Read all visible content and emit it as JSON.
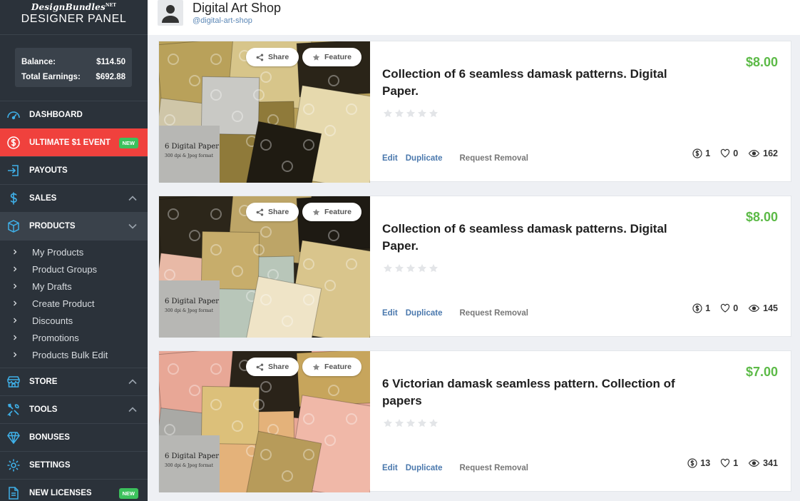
{
  "brand": {
    "logo": "DesignBundles",
    "logo_suffix": "NET",
    "panel_title": "DESIGNER PANEL"
  },
  "balance": {
    "balance_label": "Balance:",
    "balance_value": "$114.50",
    "earnings_label": "Total Earnings:",
    "earnings_value": "$692.88"
  },
  "nav": {
    "dashboard": "DASHBOARD",
    "event": "ULTIMATE $1 EVENT",
    "event_badge": "NEW",
    "payouts": "PAYOUTS",
    "sales": "SALES",
    "products": "PRODUCTS",
    "store": "STORE",
    "tools": "TOOLS",
    "bonuses": "BONUSES",
    "settings": "SETTINGS",
    "licenses": "NEW LICENSES",
    "licenses_badge": "NEW"
  },
  "products_menu": [
    "My Products",
    "Product Groups",
    "My Drafts",
    "Create Product",
    "Discounts",
    "Promotions",
    "Products Bulk Edit"
  ],
  "header": {
    "shop_name": "Digital Art Shop",
    "shop_handle": "@digital-art-shop"
  },
  "card_labels": {
    "share": "Share",
    "feature": "Feature",
    "edit": "Edit",
    "duplicate": "Duplicate",
    "remove": "Request Removal"
  },
  "products": [
    {
      "title": "Collection of 6 seamless damask patterns. Digital Paper.",
      "price": "$8.00",
      "sales": "1",
      "likes": "0",
      "views": "162",
      "thumb_caption": "6 Digital Paper",
      "thumb_sub": "300 dpi & Jpeg format"
    },
    {
      "title": "Collection of 6 seamless damask patterns. Digital Paper.",
      "price": "$8.00",
      "sales": "1",
      "likes": "0",
      "views": "145",
      "thumb_caption": "6 Digital Paper",
      "thumb_sub": "300 dpi & Jpeg format"
    },
    {
      "title": "6 Victorian damask seamless pattern. Collection of papers",
      "price": "$7.00",
      "sales": "13",
      "likes": "1",
      "views": "341",
      "thumb_caption": "6 Digital Paper",
      "thumb_sub": "300 dpi & Jpeg format"
    }
  ],
  "colors": {
    "sidebar": "#2b323a",
    "event": "#f0413d",
    "badge": "#3cc15c",
    "price": "#5cba47",
    "link": "#4a78ad"
  }
}
